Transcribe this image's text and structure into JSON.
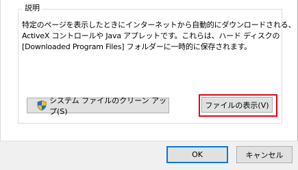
{
  "group": {
    "title": "説明",
    "description_lines": [
      "特定のページを表示したときにインターネットから自動的にダウンロードされる、",
      "ActiveX コントロールや Java アプレットです。これらは、ハード ディスクの",
      "[Downloaded Program Files] フォルダーに一時的に保存されます。"
    ]
  },
  "buttons": {
    "cleanup_label": "システム ファイルのクリーン アップ(S)",
    "cleanup_icon": "uac-shield-icon",
    "view_files_label": "ファイルの表示(V)",
    "ok_label": "OK",
    "cancel_label": "キャンセル"
  },
  "colors": {
    "highlight": "#e60012",
    "default_button_border": "#0078d7"
  }
}
